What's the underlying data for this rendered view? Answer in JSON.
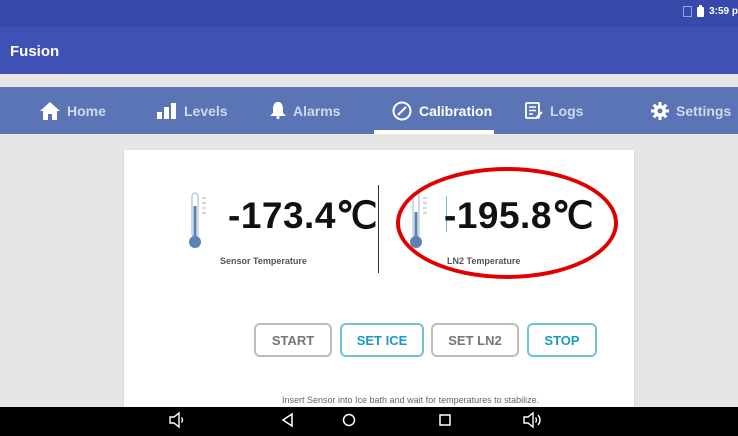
{
  "status_bar": {
    "time": "3:59 p"
  },
  "app_bar": {
    "title": "Fusion"
  },
  "tabs": [
    {
      "label": "Home",
      "icon": "home-icon"
    },
    {
      "label": "Levels",
      "icon": "bars-icon"
    },
    {
      "label": "Alarms",
      "icon": "bell-icon"
    },
    {
      "label": "Calibration",
      "icon": "gauge-icon",
      "active": true
    },
    {
      "label": "Logs",
      "icon": "log-icon"
    },
    {
      "label": "Settings",
      "icon": "gear-icon"
    }
  ],
  "readings": {
    "sensor": {
      "value": "-173.4℃",
      "label": "Sensor Temperature"
    },
    "ln2": {
      "value": "-195.8℃",
      "label": "LN2 Temperature"
    }
  },
  "buttons": {
    "start": "START",
    "set_ice": "SET ICE",
    "set_ln2": "SET LN2",
    "stop": "STOP"
  },
  "instruction": "Insert Sensor into Ice bath and wait for temperatures to stabilize.",
  "colors": {
    "status_bar": "#3949ab",
    "app_bar": "#3f51b5",
    "tab_bar": "#5b74b6",
    "accent_blue": "#1c98c0",
    "highlight_red": "#e00000"
  }
}
